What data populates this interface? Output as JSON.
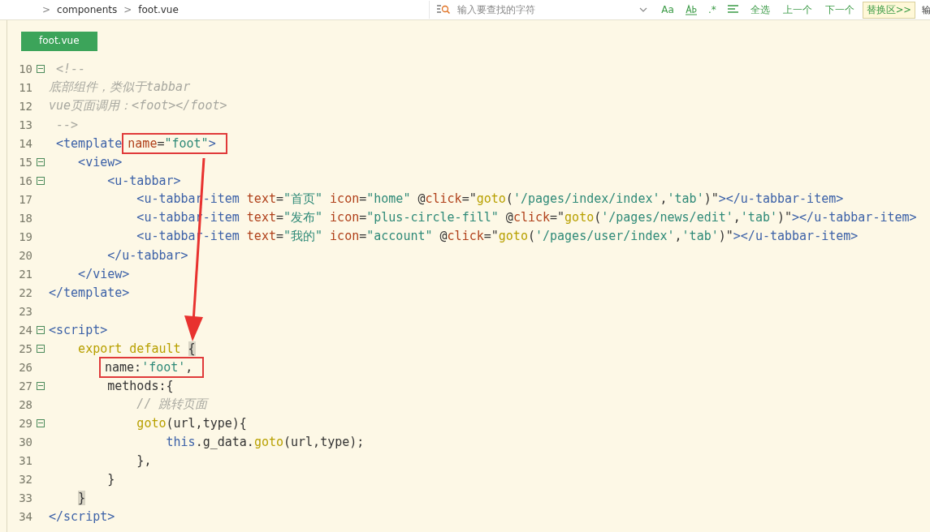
{
  "breadcrumb": {
    "separator": ">",
    "items": [
      "components",
      "foot.vue"
    ]
  },
  "find_bar": {
    "placeholder": "输入要查找的字符",
    "options": [
      {
        "kind": "text",
        "label": "Aa"
      },
      {
        "kind": "whole-word"
      },
      {
        "kind": "text",
        "label": ".*"
      },
      {
        "kind": "lines"
      }
    ],
    "buttons": [
      "全选",
      "上一个",
      "下一个"
    ],
    "replace_toggle": "替换区>>",
    "cut_label": "输"
  },
  "tabs": [
    {
      "label": "foot.vue",
      "selected": true
    }
  ],
  "lines": [
    {
      "number": "10",
      "fold": true,
      "tokens": [
        {
          "kind": "comment",
          "text": " <!--"
        }
      ]
    },
    {
      "number": "11",
      "fold": false,
      "tokens": [
        {
          "kind": "comment",
          "text": "底部组件，类似于tabbar"
        }
      ]
    },
    {
      "number": "12",
      "fold": false,
      "tokens": [
        {
          "kind": "comment",
          "text": "vue页面调用：<foot></foot>"
        }
      ]
    },
    {
      "number": "13",
      "fold": false,
      "tokens": [
        {
          "kind": "comment",
          "text": " -->"
        }
      ]
    },
    {
      "number": "14",
      "fold": false,
      "tokens": [
        {
          "kind": "tag",
          "text": " <template"
        }
      ],
      "callout": [
        {
          "kind": "attr",
          "text": "name"
        },
        {
          "kind": "plain",
          "text": "="
        },
        {
          "kind": "str",
          "text": "\"foot\""
        },
        {
          "kind": "tag",
          "text": ">"
        }
      ]
    },
    {
      "number": "15",
      "fold": true,
      "tokens": [
        {
          "kind": "tag",
          "text": "    <view>"
        }
      ]
    },
    {
      "number": "16",
      "fold": true,
      "tokens": [
        {
          "kind": "tag",
          "text": "        <u-tabbar>"
        }
      ]
    },
    {
      "number": "17",
      "fold": false,
      "tokens": [
        {
          "kind": "tag",
          "text": "            <u-tabbar-item"
        },
        {
          "kind": "attr",
          "text": " text"
        },
        {
          "kind": "plain",
          "text": "="
        },
        {
          "kind": "str",
          "text": "\"首页\""
        },
        {
          "kind": "attr",
          "text": " icon"
        },
        {
          "kind": "plain",
          "text": "="
        },
        {
          "kind": "str",
          "text": "\"home\""
        },
        {
          "kind": "plain",
          "text": " @"
        },
        {
          "kind": "attr",
          "text": "click"
        },
        {
          "kind": "plain",
          "text": "=\""
        },
        {
          "kind": "fn",
          "text": "goto"
        },
        {
          "kind": "plain",
          "text": "("
        },
        {
          "kind": "str",
          "text": "'/pages/index/index'"
        },
        {
          "kind": "plain",
          "text": ","
        },
        {
          "kind": "str",
          "text": "'tab'"
        },
        {
          "kind": "plain",
          "text": ")\""
        },
        {
          "kind": "tag",
          "text": "></u-tabbar-item>"
        }
      ]
    },
    {
      "number": "18",
      "fold": false,
      "tokens": [
        {
          "kind": "tag",
          "text": "            <u-tabbar-item"
        },
        {
          "kind": "attr",
          "text": " text"
        },
        {
          "kind": "plain",
          "text": "="
        },
        {
          "kind": "str",
          "text": "\"发布\""
        },
        {
          "kind": "attr",
          "text": " icon"
        },
        {
          "kind": "plain",
          "text": "="
        },
        {
          "kind": "str",
          "text": "\"plus-circle-fill\""
        },
        {
          "kind": "plain",
          "text": " @"
        },
        {
          "kind": "attr",
          "text": "click"
        },
        {
          "kind": "plain",
          "text": "=\""
        },
        {
          "kind": "fn",
          "text": "goto"
        },
        {
          "kind": "plain",
          "text": "("
        },
        {
          "kind": "str",
          "text": "'/pages/news/edit'"
        },
        {
          "kind": "plain",
          "text": ","
        },
        {
          "kind": "str",
          "text": "'tab'"
        },
        {
          "kind": "plain",
          "text": ")\""
        },
        {
          "kind": "tag",
          "text": "></u-tabbar-item>"
        }
      ]
    },
    {
      "number": "19",
      "fold": false,
      "tokens": [
        {
          "kind": "tag",
          "text": "            <u-tabbar-item"
        },
        {
          "kind": "attr",
          "text": " text"
        },
        {
          "kind": "plain",
          "text": "="
        },
        {
          "kind": "str",
          "text": "\"我的\""
        },
        {
          "kind": "attr",
          "text": " icon"
        },
        {
          "kind": "plain",
          "text": "="
        },
        {
          "kind": "str",
          "text": "\"account\""
        },
        {
          "kind": "plain",
          "text": " @"
        },
        {
          "kind": "attr",
          "text": "click"
        },
        {
          "kind": "plain",
          "text": "=\""
        },
        {
          "kind": "fn",
          "text": "goto"
        },
        {
          "kind": "plain",
          "text": "("
        },
        {
          "kind": "str",
          "text": "'/pages/user/index'"
        },
        {
          "kind": "plain",
          "text": ","
        },
        {
          "kind": "str",
          "text": "'tab'"
        },
        {
          "kind": "plain",
          "text": ")\""
        },
        {
          "kind": "tag",
          "text": "></u-tabbar-item>"
        }
      ]
    },
    {
      "number": "20",
      "fold": false,
      "tokens": [
        {
          "kind": "tag",
          "text": "        </u-tabbar>"
        }
      ]
    },
    {
      "number": "21",
      "fold": false,
      "tokens": [
        {
          "kind": "tag",
          "text": "    </view>"
        }
      ]
    },
    {
      "number": "22",
      "fold": false,
      "tokens": [
        {
          "kind": "tag",
          "text": "</template>"
        }
      ]
    },
    {
      "number": "23",
      "fold": false
    },
    {
      "number": "24",
      "fold": true,
      "tokens": [
        {
          "kind": "tag",
          "text": "<script>"
        }
      ]
    },
    {
      "number": "25",
      "fold": true,
      "tokens": [
        {
          "kind": "kw",
          "text": "    export default "
        },
        {
          "kind": "match",
          "text": "{"
        }
      ]
    },
    {
      "number": "26",
      "fold": false,
      "callout": [
        {
          "kind": "plain",
          "text": "name:"
        },
        {
          "kind": "str",
          "text": "'foot'"
        },
        {
          "kind": "plain",
          "text": ","
        }
      ]
    },
    {
      "number": "27",
      "fold": true,
      "tokens": [
        {
          "kind": "plain",
          "text": "        methods:{"
        }
      ]
    },
    {
      "number": "28",
      "fold": false,
      "tokens": [
        {
          "kind": "comment",
          "text": "            // 跳转页面"
        }
      ]
    },
    {
      "number": "29",
      "fold": true,
      "tokens": [
        {
          "kind": "fn",
          "text": "            goto"
        },
        {
          "kind": "plain",
          "text": "(url,type){"
        }
      ]
    },
    {
      "number": "30",
      "fold": false,
      "tokens": [
        {
          "kind": "tag",
          "text": "                this"
        },
        {
          "kind": "plain",
          "text": ".g_data."
        },
        {
          "kind": "fn",
          "text": "goto"
        },
        {
          "kind": "plain",
          "text": "(url,type);"
        }
      ]
    },
    {
      "number": "31",
      "fold": false,
      "tokens": [
        {
          "kind": "plain",
          "text": "            },"
        }
      ]
    },
    {
      "number": "32",
      "fold": false,
      "tokens": [
        {
          "kind": "plain",
          "text": "        }"
        }
      ]
    },
    {
      "number": "33",
      "fold": false,
      "tokens": [
        {
          "kind": "match",
          "text": "}"
        }
      ]
    },
    {
      "number": "34",
      "fold": false,
      "tokens": [
        {
          "kind": "tag",
          "text": "</script>"
        }
      ]
    }
  ]
}
